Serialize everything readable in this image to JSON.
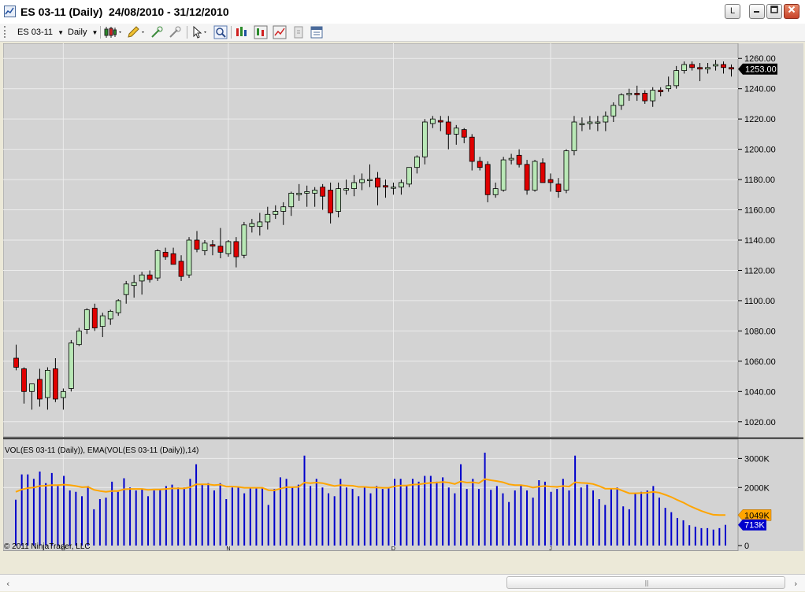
{
  "window": {
    "title": "ES 03-11 (Daily)  24/08/2010 - 31/12/2010",
    "link_button": "L"
  },
  "toolbar": {
    "instrument": "ES 03-11",
    "interval": "Daily"
  },
  "chart_data": [
    {
      "type": "candlestick",
      "title": "",
      "ylabel": "",
      "ylim": [
        1010,
        1270
      ],
      "yticks": [
        1020,
        1040,
        1060,
        1080,
        1100,
        1120,
        1140,
        1160,
        1180,
        1200,
        1220,
        1240,
        1260
      ],
      "ytick_labels": [
        "1020.00",
        "1040.00",
        "1060.00",
        "1080.00",
        "1100.00",
        "1120.00",
        "1140.00",
        "1160.00",
        "1180.00",
        "1200.00",
        "1220.00",
        "1240.00",
        "1260.00"
      ],
      "last_price_label": "1253.00",
      "last_price": 1253.0,
      "up_color": "#b9e8b6",
      "down_color": "#e00000",
      "candles": [
        [
          1062,
          1071,
          1054,
          1056
        ],
        [
          1055,
          1056,
          1032,
          1040
        ],
        [
          1040,
          1045,
          1028,
          1045
        ],
        [
          1048,
          1055,
          1030,
          1035
        ],
        [
          1036,
          1056,
          1028,
          1054
        ],
        [
          1055,
          1062,
          1033,
          1035
        ],
        [
          1036,
          1042,
          1028,
          1040
        ],
        [
          1042,
          1074,
          1040,
          1072
        ],
        [
          1071,
          1082,
          1070,
          1080
        ],
        [
          1081,
          1095,
          1078,
          1094
        ],
        [
          1095,
          1098,
          1080,
          1082
        ],
        [
          1083,
          1092,
          1076,
          1090
        ],
        [
          1088,
          1094,
          1084,
          1093
        ],
        [
          1092,
          1101,
          1090,
          1100
        ],
        [
          1104,
          1113,
          1098,
          1111
        ],
        [
          1110,
          1117,
          1102,
          1112
        ],
        [
          1113,
          1119,
          1104,
          1117
        ],
        [
          1117,
          1120,
          1112,
          1114
        ],
        [
          1115,
          1134,
          1113,
          1133
        ],
        [
          1132,
          1135,
          1127,
          1129
        ],
        [
          1131,
          1135,
          1124,
          1124
        ],
        [
          1126,
          1130,
          1113,
          1116
        ],
        [
          1117,
          1142,
          1115,
          1140
        ],
        [
          1140,
          1146,
          1132,
          1134
        ],
        [
          1133,
          1140,
          1130,
          1138
        ],
        [
          1137,
          1140,
          1130,
          1136
        ],
        [
          1136,
          1148,
          1128,
          1132
        ],
        [
          1131,
          1140,
          1129,
          1139
        ],
        [
          1139,
          1142,
          1122,
          1129
        ],
        [
          1130,
          1152,
          1128,
          1150
        ],
        [
          1149,
          1154,
          1145,
          1151
        ],
        [
          1149,
          1158,
          1143,
          1152
        ],
        [
          1152,
          1162,
          1147,
          1157
        ],
        [
          1157,
          1163,
          1154,
          1159
        ],
        [
          1159,
          1165,
          1150,
          1162
        ],
        [
          1162,
          1172,
          1156,
          1171
        ],
        [
          1170,
          1177,
          1166,
          1171
        ],
        [
          1171,
          1176,
          1162,
          1172
        ],
        [
          1171,
          1175,
          1162,
          1173
        ],
        [
          1175,
          1177,
          1160,
          1169
        ],
        [
          1173,
          1178,
          1151,
          1158
        ],
        [
          1159,
          1178,
          1155,
          1174
        ],
        [
          1173,
          1180,
          1170,
          1174
        ],
        [
          1174,
          1183,
          1169,
          1178
        ],
        [
          1178,
          1184,
          1173,
          1180
        ],
        [
          1180,
          1190,
          1175,
          1180
        ],
        [
          1181,
          1185,
          1163,
          1175
        ],
        [
          1176,
          1180,
          1168,
          1175
        ],
        [
          1175,
          1178,
          1170,
          1175
        ],
        [
          1175,
          1180,
          1170,
          1178
        ],
        [
          1177,
          1188,
          1175,
          1188
        ],
        [
          1188,
          1196,
          1184,
          1195
        ],
        [
          1195,
          1220,
          1190,
          1218
        ],
        [
          1217,
          1222,
          1214,
          1220
        ],
        [
          1219,
          1222,
          1212,
          1218
        ],
        [
          1218,
          1222,
          1200,
          1210
        ],
        [
          1210,
          1216,
          1203,
          1214
        ],
        [
          1213,
          1214,
          1204,
          1208
        ],
        [
          1208,
          1210,
          1186,
          1192
        ],
        [
          1192,
          1195,
          1186,
          1188
        ],
        [
          1190,
          1192,
          1165,
          1170
        ],
        [
          1170,
          1178,
          1168,
          1174
        ],
        [
          1173,
          1195,
          1172,
          1193
        ],
        [
          1193,
          1197,
          1190,
          1194
        ],
        [
          1196,
          1200,
          1188,
          1190
        ],
        [
          1190,
          1193,
          1170,
          1173
        ],
        [
          1173,
          1193,
          1172,
          1192
        ],
        [
          1191,
          1194,
          1178,
          1178
        ],
        [
          1180,
          1184,
          1172,
          1178
        ],
        [
          1177,
          1181,
          1168,
          1172
        ],
        [
          1173,
          1200,
          1171,
          1199
        ],
        [
          1199,
          1222,
          1196,
          1218
        ],
        [
          1217,
          1221,
          1212,
          1217
        ],
        [
          1217,
          1222,
          1213,
          1218
        ],
        [
          1218,
          1222,
          1212,
          1218
        ],
        [
          1218,
          1225,
          1212,
          1222
        ],
        [
          1222,
          1231,
          1218,
          1229
        ],
        [
          1229,
          1237,
          1226,
          1236
        ],
        [
          1236,
          1240,
          1232,
          1237
        ],
        [
          1237,
          1242,
          1232,
          1236
        ],
        [
          1237,
          1239,
          1230,
          1232
        ],
        [
          1232,
          1241,
          1228,
          1239
        ],
        [
          1239,
          1241,
          1235,
          1238
        ],
        [
          1240,
          1248,
          1238,
          1242
        ],
        [
          1242,
          1255,
          1240,
          1252
        ],
        [
          1252,
          1258,
          1250,
          1256
        ],
        [
          1256,
          1258,
          1252,
          1254
        ],
        [
          1254,
          1257,
          1245,
          1253
        ],
        [
          1253,
          1257,
          1250,
          1254
        ],
        [
          1255,
          1259,
          1252,
          1256
        ],
        [
          1256,
          1258,
          1250,
          1254
        ],
        [
          1254,
          1256,
          1248,
          1253
        ]
      ]
    },
    {
      "type": "bar+line",
      "title": "VOL(ES 03-11 (Daily)), EMA(VOL(ES 03-11 (Daily)),14)",
      "ylim": [
        0,
        3200000
      ],
      "yticks": [
        0,
        2000000,
        3000000
      ],
      "ytick_labels": [
        "0",
        "2000K",
        "3000K"
      ],
      "last_ema_label": "1049K",
      "last_volume_label": "713K",
      "bar_color": "#0000cc",
      "line_color": "#ffa500",
      "x_tick_labels": [
        "O",
        "N",
        "D",
        "J"
      ],
      "series": [
        {
          "values": [
            1580000,
            2450000,
            2450000,
            2300000,
            2550000,
            2150000,
            2500000,
            2050000,
            2400000,
            1900000,
            1850000,
            1700000,
            2050000,
            1250000,
            1600000,
            1650000,
            2200000,
            1850000,
            2320000,
            2000000,
            1900000,
            1950000,
            1700000,
            1900000,
            1950000,
            2050000,
            2100000,
            2000000,
            2000000,
            2300000,
            2800000,
            2100000,
            2150000,
            1900000,
            2150000,
            1600000,
            2000000,
            2000000,
            1800000,
            2000000,
            2000000,
            2000000,
            1400000,
            1950000,
            2350000,
            2300000,
            2000000,
            2100000,
            3100000,
            2050000,
            2300000,
            2000000,
            1800000,
            1700000,
            2300000,
            2000000,
            1950000,
            1700000,
            2000000,
            1800000,
            2050000,
            1950000,
            2000000,
            2300000,
            2300000,
            2050000,
            2300000,
            2200000,
            2400000,
            2400000,
            2200000,
            2350000,
            2000000,
            1800000,
            2800000,
            1950000,
            2300000,
            1950000,
            3200000,
            1920000,
            2050000,
            1800000,
            1500000,
            1900000,
            2100000,
            1900000,
            1650000,
            2250000,
            2200000,
            1850000,
            1950000,
            2300000,
            1900000,
            3100000,
            2000000,
            2100000,
            1900000,
            1600000,
            1400000,
            1950000,
            2000000,
            1350000,
            1250000,
            1800000,
            1850000,
            1900000,
            2050000,
            1650000,
            1300000,
            1150000,
            950000,
            870000,
            700000,
            650000,
            600000,
            600000,
            550000,
            600000,
            713000
          ]
        },
        {
          "values": [
            1850000,
            1930000,
            1980000,
            2000000,
            2050000,
            2060000,
            2080000,
            2080000,
            2100000,
            2080000,
            2050000,
            2010000,
            2020000,
            1920000,
            1880000,
            1850000,
            1880000,
            1880000,
            1940000,
            1950000,
            1950000,
            1950000,
            1920000,
            1930000,
            1930000,
            1950000,
            1970000,
            1970000,
            1970000,
            2010000,
            2110000,
            2110000,
            2110000,
            2080000,
            2100000,
            2030000,
            2030000,
            2020000,
            1990000,
            1990000,
            1990000,
            1990000,
            1910000,
            1900000,
            1960000,
            2010000,
            2010000,
            2020000,
            2170000,
            2150000,
            2170000,
            2150000,
            2100000,
            2050000,
            2080000,
            2070000,
            2060000,
            2020000,
            2020000,
            2000000,
            2000000,
            1990000,
            1990000,
            2040000,
            2070000,
            2070000,
            2100000,
            2110000,
            2140000,
            2160000,
            2170000,
            2190000,
            2170000,
            2120000,
            2210000,
            2170000,
            2180000,
            2150000,
            2290000,
            2250000,
            2220000,
            2180000,
            2110000,
            2080000,
            2080000,
            2050000,
            2000000,
            2030000,
            2050000,
            2030000,
            2020000,
            2050000,
            2030000,
            2180000,
            2160000,
            2150000,
            2120000,
            2050000,
            1960000,
            1960000,
            1960000,
            1880000,
            1800000,
            1800000,
            1810000,
            1820000,
            1850000,
            1820000,
            1750000,
            1670000,
            1570000,
            1480000,
            1370000,
            1280000,
            1190000,
            1120000,
            1060000,
            1050000,
            1049000
          ]
        }
      ]
    }
  ],
  "copyright": "© 2011 NinjaTrader, LLC"
}
